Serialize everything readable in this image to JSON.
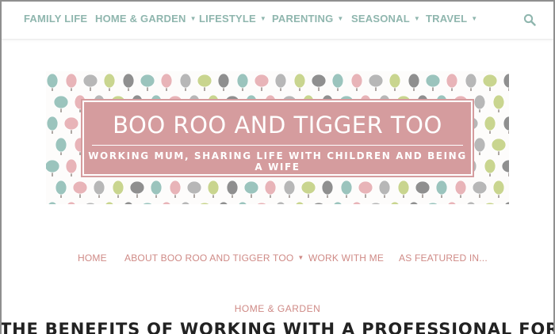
{
  "topnav": {
    "items": [
      {
        "label": "FAMILY LIFE",
        "has_dropdown": false
      },
      {
        "label": "HOME & GARDEN",
        "has_dropdown": true
      },
      {
        "label": "LIFESTYLE",
        "has_dropdown": true
      },
      {
        "label": "PARENTING",
        "has_dropdown": true
      },
      {
        "label": "SEASONAL",
        "has_dropdown": true
      },
      {
        "label": "TRAVEL",
        "has_dropdown": true
      }
    ],
    "search_icon": "search-icon"
  },
  "banner": {
    "title": "BOO ROO AND TIGGER TOO",
    "tagline": "WORKING MUM, SHARING LIFE WITH CHILDREN AND BEING A WIFE"
  },
  "subnav": {
    "items": [
      {
        "label": "HOME",
        "has_dropdown": false
      },
      {
        "label": "ABOUT BOO ROO AND TIGGER TOO",
        "has_dropdown": true
      },
      {
        "label": "WORK WITH ME",
        "has_dropdown": false
      },
      {
        "label": "AS FEATURED IN...",
        "has_dropdown": false
      }
    ]
  },
  "post": {
    "category": "HOME & GARDEN",
    "title": "THE BENEFITS OF WORKING WITH A PROFESSIONAL FOR"
  },
  "colors": {
    "topnav_text": "#8fb6ae",
    "accent_pink": "#d59c9e",
    "subnav_text": "#cf8a86",
    "tree_colors": [
      "#9bc4bd",
      "#c9d58f",
      "#e8b4b8",
      "#8f8f8f",
      "#b7b7b7"
    ]
  }
}
